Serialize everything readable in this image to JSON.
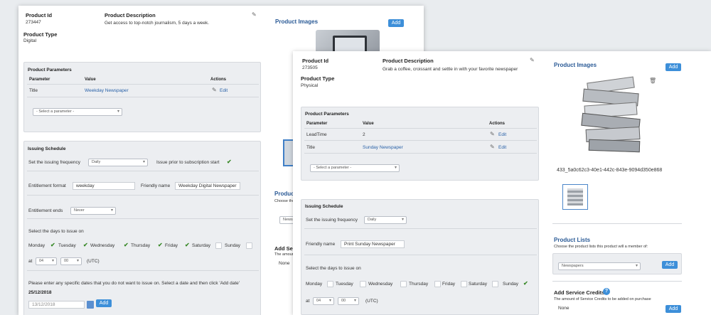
{
  "back": {
    "product_id_label": "Product Id",
    "product_id": "273447",
    "product_type_label": "Product Type",
    "product_type": "Digital",
    "desc_label": "Product Description",
    "desc": "Get access to top-notch journalism, 5 days a week.",
    "images_title": "Product Images",
    "add_label": "Add",
    "params_title": "Product Parameters",
    "col_param": "Parameter",
    "col_value": "Value",
    "col_actions": "Actions",
    "rows": [
      {
        "param": "Title",
        "value": "Weekday Newspaper",
        "action": "Edit"
      }
    ],
    "select_param": "- Select a parameter -",
    "issuing_title": "Issuing Schedule",
    "freq_label": "Set the issuing frequency",
    "freq_value": "Daily",
    "issue_prior_label": "Issue prior to subscription start",
    "ent_format_label": "Entitlement format",
    "ent_format_value": "weekday",
    "friendly_label": "Friendly name",
    "friendly_value": "Weekday Digital Newspaper",
    "ent_ends_label": "Entitlement ends",
    "ent_ends_value": "Never",
    "days_label": "Select the days to issue on",
    "days": [
      {
        "name": "Monday",
        "checked": true
      },
      {
        "name": "Tuesday",
        "checked": true
      },
      {
        "name": "Wednesday",
        "checked": true
      },
      {
        "name": "Thursday",
        "checked": true
      },
      {
        "name": "Friday",
        "checked": true
      },
      {
        "name": "Saturday",
        "checked": false
      },
      {
        "name": "Sunday",
        "checked": false
      }
    ],
    "at_label": "at",
    "hour": "04",
    "minute": "00",
    "tz": "(UTC)",
    "specific_dates_label": "Please enter any specific dates that you do not want to issue on. Select a date and then click 'Add date'",
    "listed_date": "25/12/2018",
    "date_input": "13/12/2018",
    "date_add": "Add",
    "product_lists_partial": "Product",
    "choose_partial": "Choose the",
    "newspapers_partial": "Newspap",
    "add_serv_partial": "Add Servi",
    "amount_partial": "The amount o",
    "none_label": "None"
  },
  "front": {
    "product_id_label": "Product Id",
    "product_id": "273505",
    "product_type_label": "Product Type",
    "product_type": "Physical",
    "desc_label": "Product Description",
    "desc": "Grab a coffee, croissant and settle in with your favorite newspaper",
    "images_title": "Product Images",
    "add_label": "Add",
    "image_filename": "433_5a0c62c3-40e1-442c-843e-9094d350e868",
    "params_title": "Product Parameters",
    "col_param": "Parameter",
    "col_value": "Value",
    "col_actions": "Actions",
    "rows": [
      {
        "param": "LeadTime",
        "value": "2",
        "action": "Edit"
      },
      {
        "param": "Title",
        "value": "Sunday Newspaper",
        "action": "Edit"
      }
    ],
    "select_param": "- Select a parameter -",
    "issuing_title": "Issuing Schedule",
    "freq_label": "Set the issuing frequency",
    "freq_value": "Daily",
    "friendly_label": "Friendly name",
    "friendly_value": "Print Sunday Newspaper",
    "days_label": "Select the days to issue on",
    "days": [
      {
        "name": "Monday",
        "checked": false
      },
      {
        "name": "Tuesday",
        "checked": false
      },
      {
        "name": "Wednesday",
        "checked": false
      },
      {
        "name": "Thursday",
        "checked": false
      },
      {
        "name": "Friday",
        "checked": false
      },
      {
        "name": "Saturday",
        "checked": false
      },
      {
        "name": "Sunday",
        "checked": true
      }
    ],
    "at_label": "at",
    "hour": "04",
    "minute": "00",
    "tz": "(UTC)",
    "lists_title": "Product Lists",
    "lists_desc": "Choose the product lists this product will a member of:",
    "lists_value": "Newspapers",
    "lists_add": "Add",
    "credits_title": "Add Service Credits",
    "credits_desc": "The amount of Service Credits to be added on purchase",
    "credits_value": "None",
    "credits_add": "Add"
  }
}
